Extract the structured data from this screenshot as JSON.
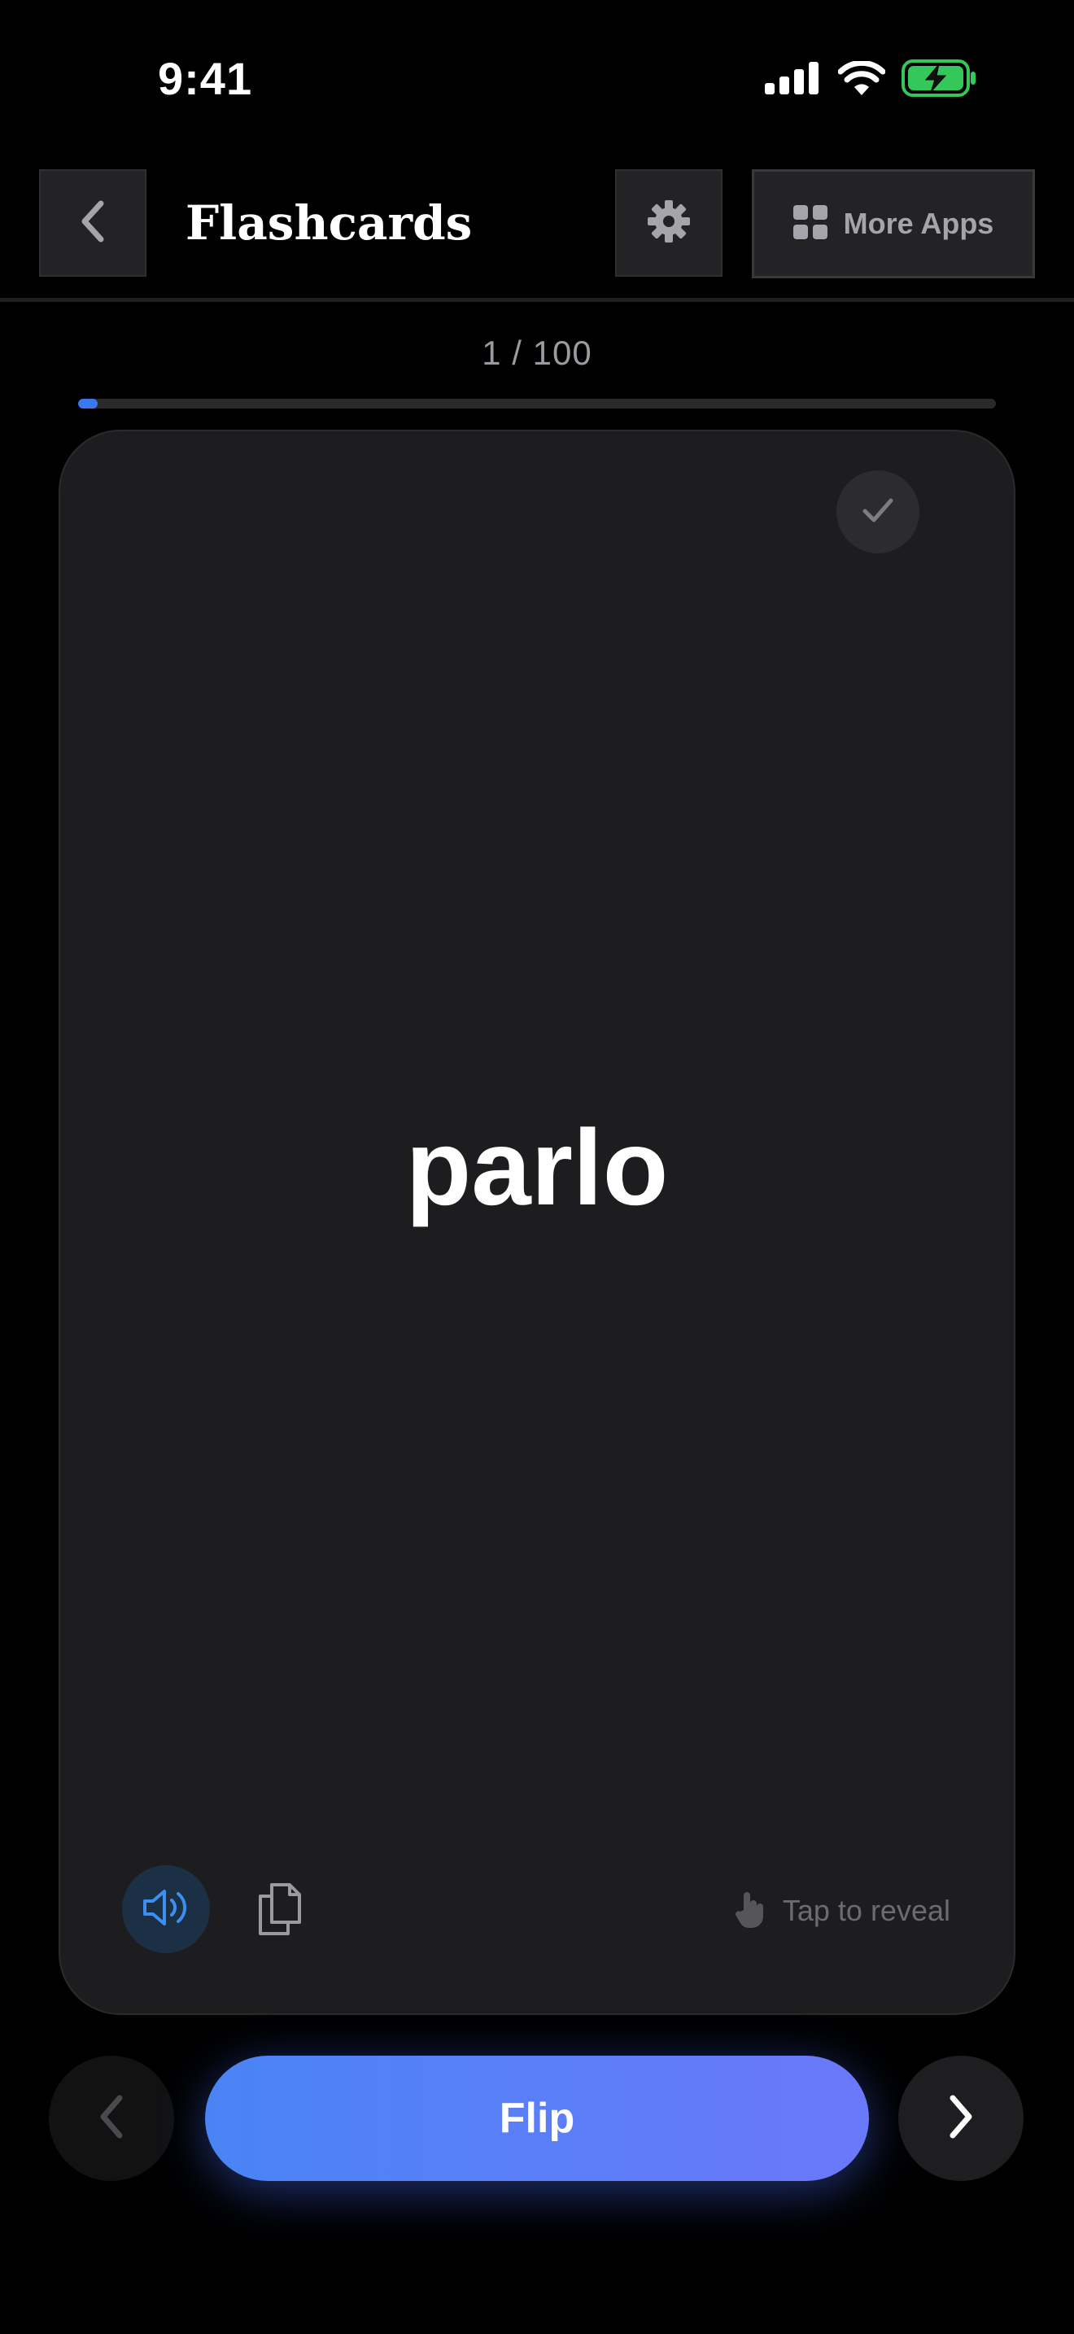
{
  "status_bar": {
    "time": "9:41",
    "icons": [
      "signal-icon",
      "wifi-icon",
      "battery-charging-icon"
    ]
  },
  "header": {
    "title": "Flashcards",
    "more_apps_label": "More Apps",
    "icons": [
      "chevron-left-icon",
      "gear-icon",
      "grid-icon"
    ]
  },
  "progress": {
    "text": "1 / 100",
    "current": 1,
    "total": 100,
    "fraction": 0.01
  },
  "card": {
    "word": "parlo",
    "hint": "Tap to reveal",
    "icons": [
      "check-icon",
      "speaker-icon",
      "copy-icon",
      "tap-hand-icon"
    ]
  },
  "controls": {
    "flip_label": "Flip",
    "icons": [
      "chevron-left-icon",
      "chevron-right-icon"
    ]
  },
  "colors": {
    "background": "#000000",
    "card": "#1d1d1f",
    "accent": "#3a78f2",
    "flip_gradient_start": "#4a84f4",
    "flip_gradient_end": "#6b78fa",
    "battery": "#34c759"
  }
}
